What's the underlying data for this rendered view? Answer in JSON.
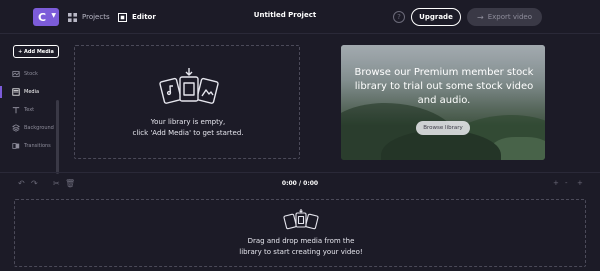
{
  "app": {
    "logo_letter": "C",
    "project_title": "Untitled Project"
  },
  "nav": {
    "projects": "Projects",
    "editor": "Editor"
  },
  "header": {
    "help": "?",
    "upgrade": "Upgrade",
    "export": "Export video"
  },
  "sidebar": {
    "add_media": "+ Add Media",
    "items": [
      {
        "label": "Stock",
        "icon": "stock-icon",
        "active": false
      },
      {
        "label": "Media",
        "icon": "media-icon",
        "active": true
      },
      {
        "label": "Text",
        "icon": "text-icon",
        "active": false
      },
      {
        "label": "Background",
        "icon": "background-icon",
        "active": false
      },
      {
        "label": "Transitions",
        "icon": "transitions-icon",
        "active": false
      }
    ]
  },
  "library": {
    "line1": "Your library is empty,",
    "line2": "click 'Add Media' to get started."
  },
  "promo": {
    "text": "Browse our Premium member stock library to trial out some stock video and audio.",
    "button": "Browse library"
  },
  "playback": {
    "timecode": "0:00 / 0:00",
    "zoom_in": "+",
    "zoom_separator": "-",
    "zoom_out": "+"
  },
  "timeline": {
    "line1": "Drag and drop media from the",
    "line2": "library to start creating your video!"
  },
  "colors": {
    "accent": "#7c5cd9",
    "background": "#1c1b27"
  }
}
